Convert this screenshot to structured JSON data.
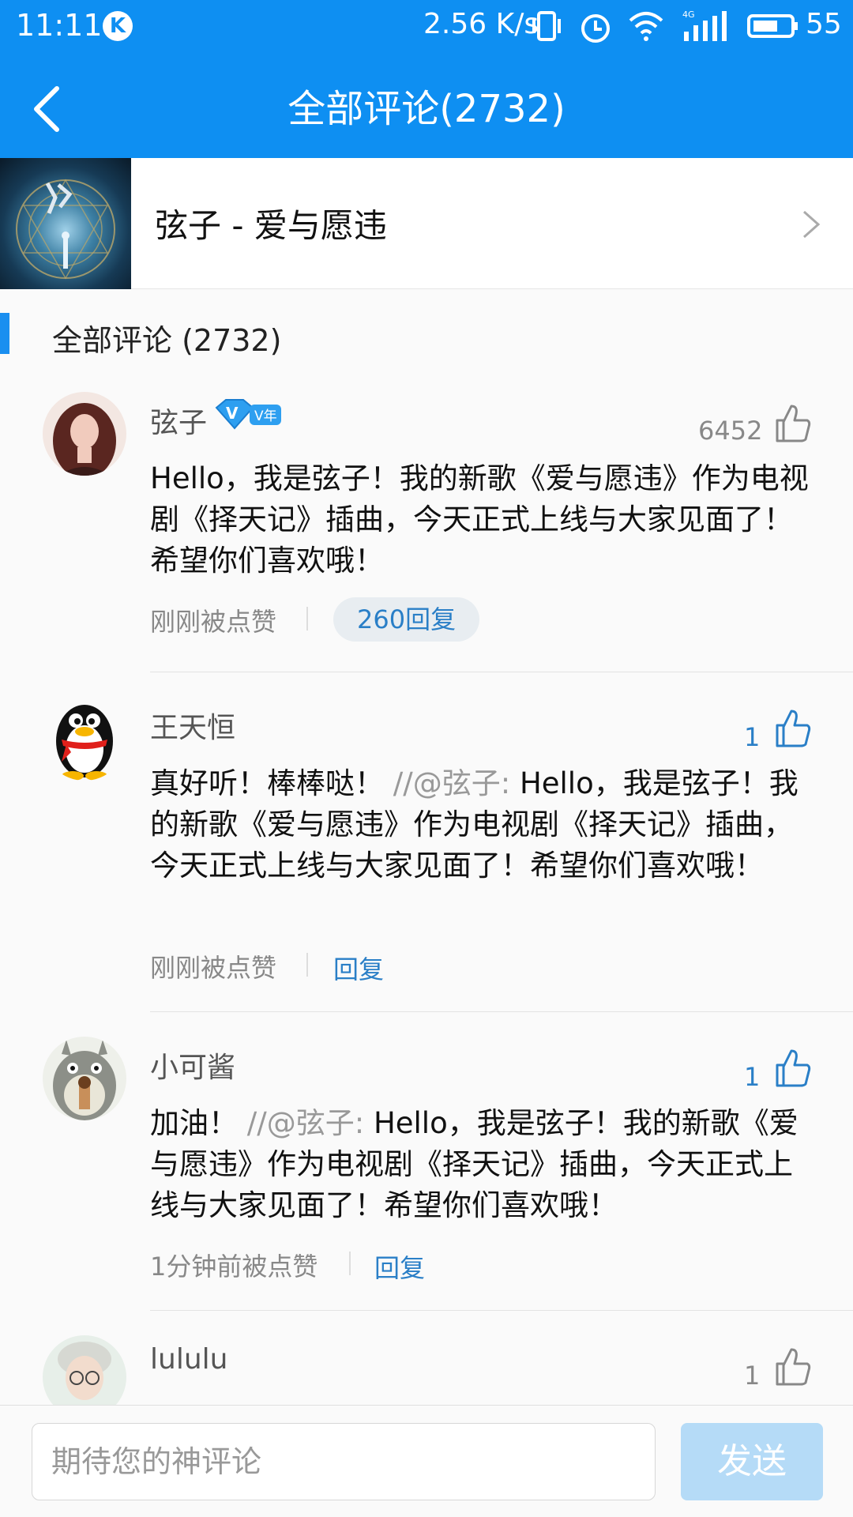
{
  "status_bar": {
    "time": "11:11",
    "app_badge": "K",
    "net_speed": "2.56 K/s",
    "battery": "55"
  },
  "nav": {
    "title": "全部评论(2732)"
  },
  "song": {
    "title": "弦子 - 爱与愿违"
  },
  "section": {
    "title": "全部评论 (2732)"
  },
  "comments": [
    {
      "user": "弦子",
      "badge": "V年",
      "likes": "6452",
      "text": "Hello，我是弦子！我的新歌《爱与愿违》作为电视剧《择天记》插曲，今天正式上线与大家见面了！希望你们喜欢哦！",
      "quote": "",
      "meta": "刚刚被点赞",
      "reply": "260回复"
    },
    {
      "user": "王天恒",
      "likes": "1",
      "text": "真好听！棒棒哒！",
      "quote": "//@弦子:",
      "quoted_text": "Hello，我是弦子！我的新歌《爱与愿违》作为电视剧《择天记》插曲，今天正式上线与大家见面了！希望你们喜欢哦！",
      "meta": "刚刚被点赞",
      "reply": "回复"
    },
    {
      "user": "小可酱",
      "likes": "1",
      "text": "加油！",
      "quote": "//@弦子:",
      "quoted_text": "Hello，我是弦子！我的新歌《爱与愿违》作为电视剧《择天记》插曲，今天正式上线与大家见面了！希望你们喜欢哦！",
      "meta": "1分钟前被点赞",
      "reply": "回复"
    },
    {
      "user": "lululu",
      "likes": "1"
    }
  ],
  "composer": {
    "placeholder": "期待您的神评论",
    "send_label": "发送"
  },
  "colors": {
    "accent": "#0e8ff2",
    "link": "#2a7fc7",
    "send_disabled": "#b5dbf7"
  }
}
